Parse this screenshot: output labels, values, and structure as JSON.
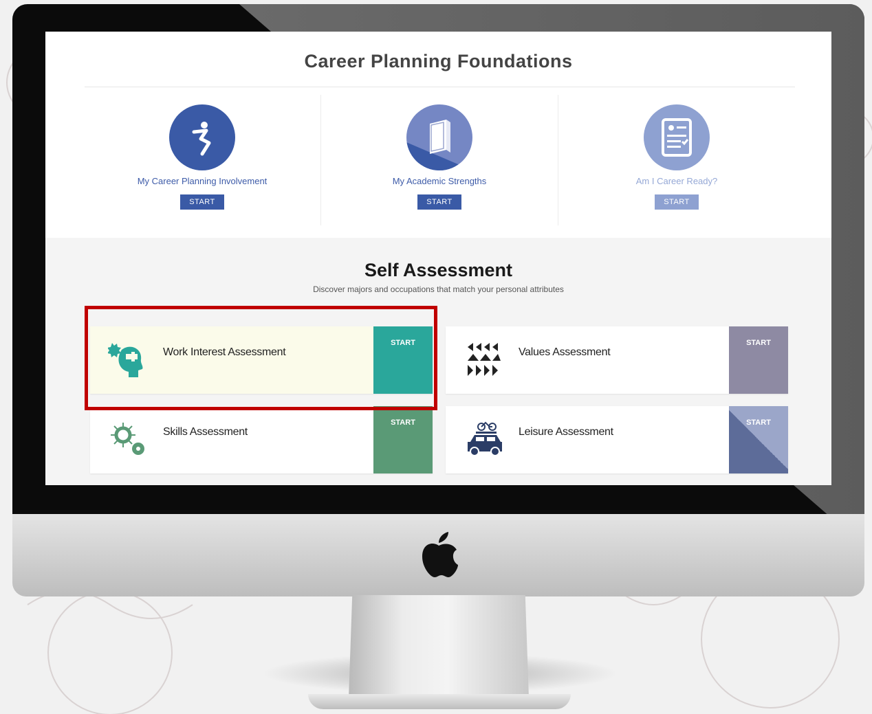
{
  "foundations": {
    "title": "Career Planning Foundations",
    "items": [
      {
        "label": "My Career Planning Involvement",
        "button": "START"
      },
      {
        "label": "My Academic Strengths",
        "button": "START"
      },
      {
        "label": "Am I Career Ready?",
        "button": "START"
      }
    ]
  },
  "self_assessment": {
    "title": "Self Assessment",
    "subtitle": "Discover majors and occupations that match your personal attributes",
    "cards": [
      {
        "label": "Work Interest Assessment",
        "button": "START",
        "color": "#2aa79b"
      },
      {
        "label": "Values Assessment",
        "button": "START",
        "color": "#8e8aa3"
      },
      {
        "label": "Skills Assessment",
        "button": "START",
        "color": "#5a9a76"
      },
      {
        "label": "Leisure Assessment",
        "button": "START",
        "color": "#6677a3"
      }
    ]
  },
  "colors": {
    "brand_blue": "#3a5aa6",
    "highlight": "#c00000"
  }
}
